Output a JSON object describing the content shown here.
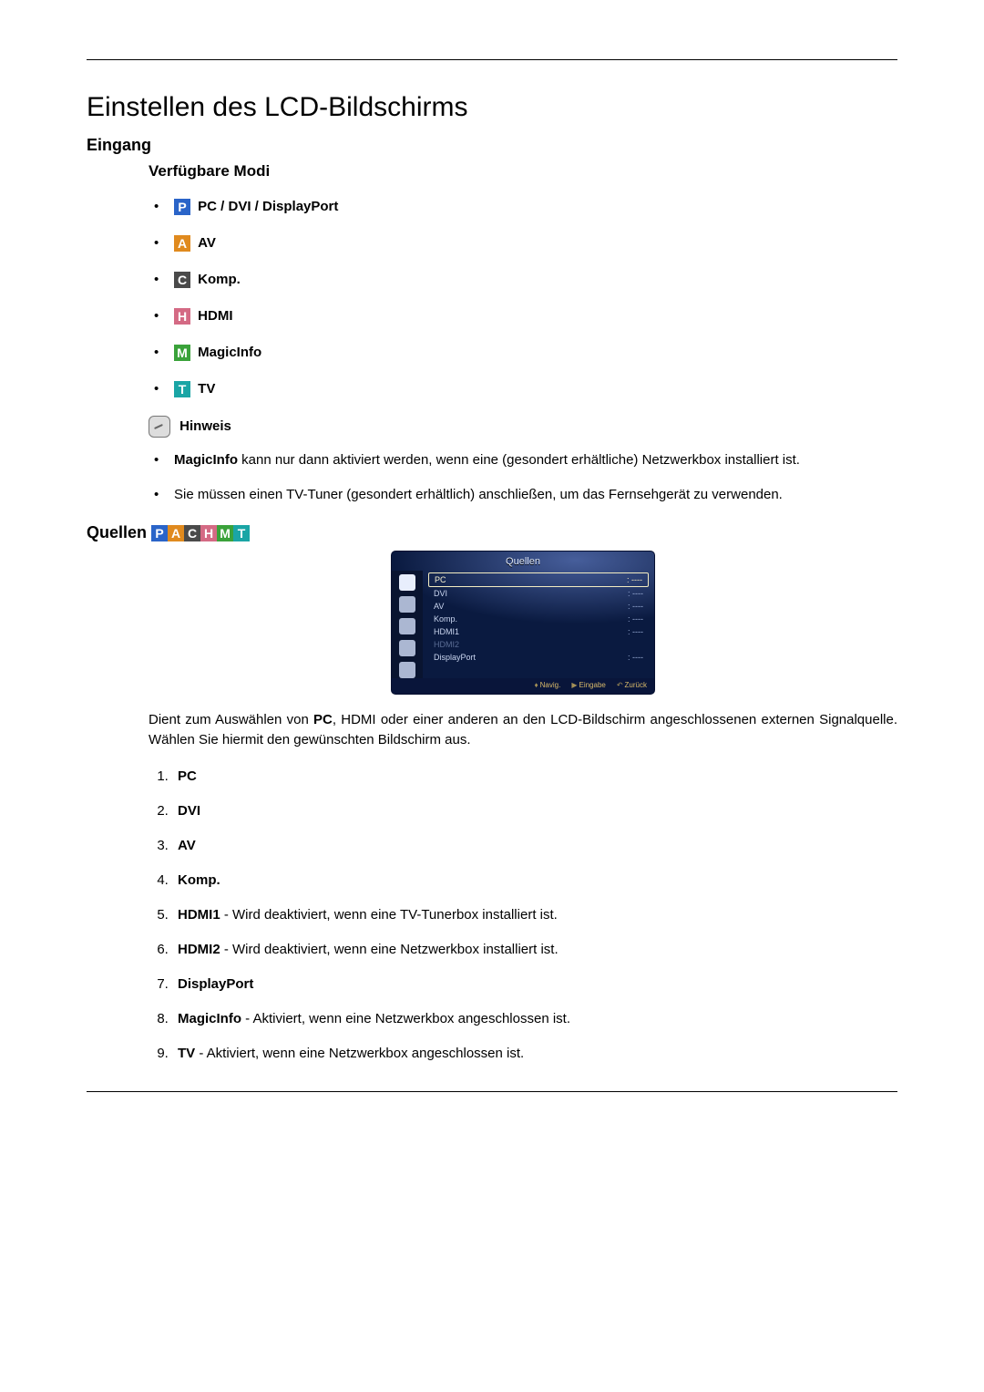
{
  "title": "Einstellen des LCD-Bildschirms",
  "section_eingang": "Eingang",
  "sub_modi": "Verfügbare Modi",
  "modes": [
    {
      "badge": "P",
      "cls": "b-P",
      "label": "PC / DVI / DisplayPort"
    },
    {
      "badge": "A",
      "cls": "b-A",
      "label": "AV"
    },
    {
      "badge": "C",
      "cls": "b-C",
      "label": "Komp."
    },
    {
      "badge": "H",
      "cls": "b-H",
      "label": "HDMI"
    },
    {
      "badge": "M",
      "cls": "b-M",
      "label": "MagicInfo"
    },
    {
      "badge": "T",
      "cls": "b-T",
      "label": "TV"
    }
  ],
  "hinweis_label": "Hinweis",
  "hinweis": {
    "n1_strong": "MagicInfo",
    "n1_rest": " kann nur dann aktiviert werden, wenn eine (gesondert erhältliche) Netzwerkbox installiert ist.",
    "n2": "Sie müssen einen TV-Tuner (gesondert erhältlich) anschließen, um das Fernsehgerät zu verwenden."
  },
  "quellen_label": "Quellen",
  "osd": {
    "title": "Quellen",
    "rows": [
      {
        "name": "PC",
        "val": ": ----",
        "active": true
      },
      {
        "name": "DVI",
        "val": ": ----"
      },
      {
        "name": "AV",
        "val": ": ----"
      },
      {
        "name": "Komp.",
        "val": ": ----"
      },
      {
        "name": "HDMI1",
        "val": ": ----"
      },
      {
        "name": "HDMI2",
        "val": "",
        "dim": true
      },
      {
        "name": "DisplayPort",
        "val": ": ----"
      }
    ],
    "foot": {
      "nav": "Navig.",
      "enter": "Eingabe",
      "back": "Zurück"
    }
  },
  "para": {
    "pre": "Dient zum Auswählen von ",
    "pc": "PC",
    "mid": ", HDMI oder einer anderen an den LCD-Bildschirm angeschlossenen externen Signalquelle. Wählen Sie hiermit den gewünschten Bildschirm aus."
  },
  "numlist": [
    {
      "strong": "PC",
      "rest": ""
    },
    {
      "strong": "DVI",
      "rest": ""
    },
    {
      "strong": "AV",
      "rest": ""
    },
    {
      "strong": "Komp.",
      "rest": ""
    },
    {
      "strong": "HDMI1",
      "rest": " - Wird deaktiviert, wenn eine TV-Tunerbox installiert ist."
    },
    {
      "strong": "HDMI2",
      "rest": " - Wird deaktiviert, wenn eine Netzwerkbox installiert ist."
    },
    {
      "strong": "DisplayPort",
      "rest": ""
    },
    {
      "strong": "MagicInfo",
      "rest": " - Aktiviert, wenn eine Netzwerkbox angeschlossen ist."
    },
    {
      "strong": "TV",
      "rest": " - Aktiviert, wenn eine Netzwerkbox angeschlossen ist."
    }
  ]
}
